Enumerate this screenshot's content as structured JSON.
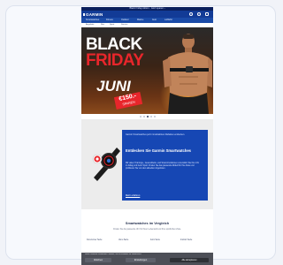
{
  "topbar": {
    "text": "Black Friday Aktion · Jetzt sparen ›"
  },
  "header": {
    "logo": "GARMIN"
  },
  "nav": {
    "items": [
      "Smartwatches",
      "Fitness",
      "Outdoor",
      "Marine",
      "Auto",
      "Luftfahrt"
    ]
  },
  "subnav": {
    "items": [
      "Angebote",
      "Neu",
      "Sport",
      "Service"
    ]
  },
  "hero": {
    "line1": "BLACK",
    "line2": "FRIDAY",
    "line3": "JUNI",
    "price_amount": "€150.-",
    "price_label": "SPAREN"
  },
  "carousel": {
    "count": 5,
    "active_index": 2
  },
  "promo": {
    "small_text": "Garmin Smartwatches jetzt mit attraktiven Rabatten entdecken.",
    "title": "Entdecken Sie Garmin Smartwatches",
    "body": "Mit vielen Trainings-, Gesundheits- und Smart-Funktionen unterstützt Sie Ihre Uhr im Alltag und beim Sport. Finden Sie das passende Modell für Ihre Ziele und profitieren Sie von den aktuellen Angeboten.",
    "link": "Mehr erfahren"
  },
  "section": {
    "title": "Smartwatches im Vergleich",
    "subtitle": "Finden Sie die passende Uhr für Ihren Lebensstil und Ihre sportlichen Ziele.",
    "columns": [
      "Forerunner Serie",
      "Venu Serie",
      "fenix Serie",
      "Instinct Serie"
    ]
  },
  "cookie": {
    "text": "Diese Website verwendet Cookies, um Ihr Erlebnis zu verbessern.",
    "decline": "Ablehnen",
    "settings": "Einstellungen",
    "accept": "Alle akzeptieren"
  },
  "colors": {
    "brand": "#123b96",
    "accent": "#e8262b",
    "promo_blue": "#1647b4"
  }
}
